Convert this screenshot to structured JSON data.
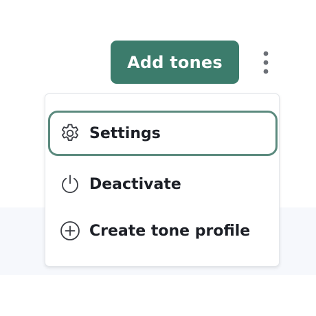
{
  "toolbar": {
    "add_button_label": "Add tones",
    "add_button_color": "#3c7c6c",
    "more_icon": "vertical-ellipsis-icon"
  },
  "menu": {
    "items": [
      {
        "label": "Settings",
        "icon": "gear-icon",
        "focused": true
      },
      {
        "label": "Deactivate",
        "icon": "power-icon",
        "focused": false
      },
      {
        "label": "Create tone profile",
        "icon": "plus-circle-icon",
        "focused": false
      }
    ],
    "focus_ring_color": "#5b8a7e"
  }
}
